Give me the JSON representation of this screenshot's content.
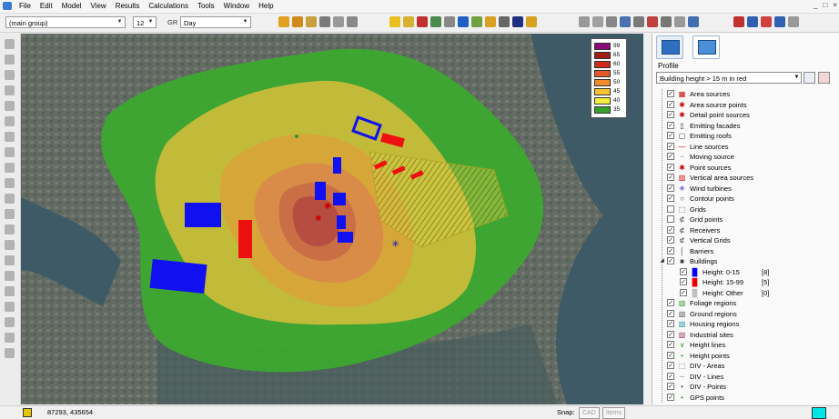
{
  "menubar": {
    "items": [
      "File",
      "Edit",
      "Model",
      "View",
      "Results",
      "Calculations",
      "Tools",
      "Window",
      "Help"
    ],
    "window_controls": [
      "_",
      "□",
      "×"
    ]
  },
  "toolbar": {
    "group_select": "(main group)",
    "size_select": "12",
    "gr_label": "GR",
    "period_select": "Day"
  },
  "legend": {
    "levels": [
      {
        "value": "99",
        "color": "#8b0a78"
      },
      {
        "value": "65",
        "color": "#a31e14"
      },
      {
        "value": "60",
        "color": "#cf2a1a"
      },
      {
        "value": "55",
        "color": "#e6582a"
      },
      {
        "value": "50",
        "color": "#f08c2c"
      },
      {
        "value": "45",
        "color": "#f5c232"
      },
      {
        "value": "40",
        "color": "#f3ef3e"
      },
      {
        "value": "35",
        "color": "#35a12a"
      }
    ]
  },
  "panel": {
    "profile_label": "Profile",
    "profile_value": "Building height > 15 m in red",
    "tree": [
      {
        "label": "Area sources",
        "checked": true,
        "icon": "area-sources-icon",
        "glyph": "▦",
        "color": "#d00000",
        "indent": 0
      },
      {
        "label": "Area source points",
        "checked": true,
        "icon": "area-source-points-icon",
        "glyph": "✱",
        "color": "#d00000",
        "indent": 0
      },
      {
        "label": "Detail point sources",
        "checked": true,
        "icon": "detail-point-sources-icon",
        "glyph": "✱",
        "color": "#d00000",
        "indent": 0
      },
      {
        "label": "Emitting facades",
        "checked": true,
        "icon": "emitting-facades-icon",
        "glyph": "▯",
        "color": "#333",
        "indent": 0
      },
      {
        "label": "Emitting roofs",
        "checked": true,
        "icon": "emitting-roofs-icon",
        "glyph": "▢",
        "color": "#333",
        "indent": 0
      },
      {
        "label": "Line sources",
        "checked": true,
        "icon": "line-sources-icon",
        "glyph": "—",
        "color": "#d00000",
        "indent": 0
      },
      {
        "label": "Moving source",
        "checked": true,
        "icon": "moving-source-icon",
        "glyph": "┄",
        "color": "#888",
        "indent": 0
      },
      {
        "label": "Point sources",
        "checked": true,
        "icon": "point-sources-icon",
        "glyph": "✱",
        "color": "#d00000",
        "indent": 0
      },
      {
        "label": "Vertical area sources",
        "checked": true,
        "icon": "vertical-area-sources-icon",
        "glyph": "▨",
        "color": "#d00000",
        "indent": 0
      },
      {
        "label": "Wind turbines",
        "checked": true,
        "icon": "wind-turbines-icon",
        "glyph": "✳",
        "color": "#1010c0",
        "indent": 0
      },
      {
        "label": "Contour points",
        "checked": true,
        "icon": "contour-points-icon",
        "glyph": "○",
        "color": "#333",
        "indent": 0
      },
      {
        "label": "Grids",
        "checked": false,
        "icon": "grids-icon",
        "glyph": "⬚",
        "color": "#333",
        "indent": 0
      },
      {
        "label": "Grid points",
        "checked": false,
        "icon": "grid-points-icon",
        "glyph": "⊄",
        "color": "#333",
        "indent": 0
      },
      {
        "label": "Receivers",
        "checked": true,
        "icon": "receivers-icon",
        "glyph": "⊄",
        "color": "#333",
        "indent": 0
      },
      {
        "label": "Vertical Grids",
        "checked": true,
        "icon": "vertical-grids-icon",
        "glyph": "⊄",
        "color": "#333",
        "indent": 0
      },
      {
        "label": "Barriers",
        "checked": true,
        "icon": "barriers-icon",
        "glyph": "│",
        "color": "#333",
        "indent": 0
      },
      {
        "label": "Buildings",
        "checked": true,
        "icon": "buildings-icon",
        "glyph": "■",
        "color": "#444",
        "indent": 0,
        "expanded": true
      },
      {
        "label": "Height: 0-15",
        "count": "[8]",
        "checked": true,
        "icon": "building-low-icon",
        "glyph": "█",
        "color": "#0000ff",
        "indent": 1
      },
      {
        "label": "Height: 15-99",
        "count": "[5]",
        "checked": true,
        "icon": "building-high-icon",
        "glyph": "█",
        "color": "#ee0000",
        "indent": 1
      },
      {
        "label": "Height: Other",
        "count": "[0]",
        "checked": true,
        "icon": "building-other-icon",
        "glyph": "█",
        "color": "#c0c0c0",
        "indent": 1
      },
      {
        "label": "Foliage regions",
        "checked": true,
        "icon": "foliage-regions-icon",
        "glyph": "▧",
        "color": "#2a9a2a",
        "indent": 0
      },
      {
        "label": "Ground regions",
        "checked": true,
        "icon": "ground-regions-icon",
        "glyph": "▧",
        "color": "#555",
        "indent": 0
      },
      {
        "label": "Housing regions",
        "checked": true,
        "icon": "housing-regions-icon",
        "glyph": "▧",
        "color": "#1a8fa0",
        "indent": 0
      },
      {
        "label": "Industrial sites",
        "checked": true,
        "icon": "industrial-sites-icon",
        "glyph": "▧",
        "color": "#a0306a",
        "indent": 0
      },
      {
        "label": "Height lines",
        "checked": true,
        "icon": "height-lines-icon",
        "glyph": "∨",
        "color": "#2a9a2a",
        "indent": 0
      },
      {
        "label": "Height points",
        "checked": true,
        "icon": "height-points-icon",
        "glyph": "•",
        "color": "#2a9a2a",
        "indent": 0
      },
      {
        "label": "DIV - Areas",
        "checked": true,
        "icon": "div-areas-icon",
        "glyph": "⬚",
        "color": "#555",
        "indent": 0
      },
      {
        "label": "DIV - Lines",
        "checked": true,
        "icon": "div-lines-icon",
        "glyph": "┈",
        "color": "#555",
        "indent": 0
      },
      {
        "label": "DIV - Points",
        "checked": true,
        "icon": "div-points-icon",
        "glyph": "•",
        "color": "#555",
        "indent": 0
      },
      {
        "label": "GPS points",
        "checked": true,
        "icon": "gps-points-icon",
        "glyph": "•",
        "color": "#2a9a2a",
        "indent": 0
      }
    ]
  },
  "status": {
    "coordinates": "87293, 435654",
    "snap_label": "Snap:",
    "cad_label": "CAD",
    "items_label": "Items"
  }
}
